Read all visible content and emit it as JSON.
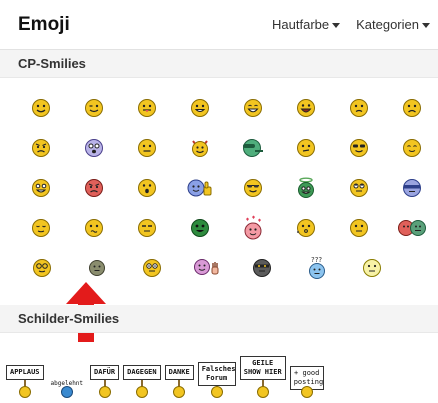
{
  "header": {
    "title": "Emoji",
    "menu_skin": "Hautfarbe",
    "menu_categories": "Kategorien"
  },
  "sections": {
    "cp_smilies": "CP-Smilies",
    "schilder": "Schilder-Smilies"
  },
  "signs": [
    {
      "text": "APPLAUS"
    },
    {
      "text": "abgelehnt"
    },
    {
      "text": "DAFÜR"
    },
    {
      "text": "DAGEGEN"
    },
    {
      "text": "DANKE"
    },
    {
      "text": "Falsches Forum"
    },
    {
      "text": "GEILE SHOW HIER"
    },
    {
      "text": "+ good posting"
    }
  ],
  "colors": {
    "accent": "#e31b1b",
    "smiley": "#f2c521"
  }
}
